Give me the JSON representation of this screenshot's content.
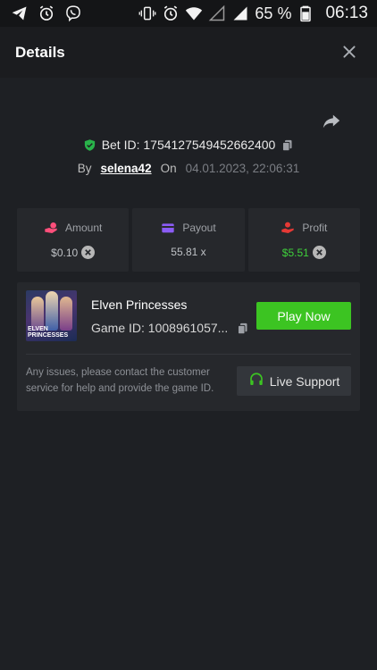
{
  "statusbar": {
    "battery_percent": "65 %",
    "time": "06:13",
    "icons": [
      "telegram-icon",
      "alarm-icon",
      "viber-icon",
      "vibrate-icon",
      "alarm-icon",
      "wifi-icon",
      "signal-empty-icon",
      "signal-icon",
      "battery-icon"
    ]
  },
  "header": {
    "title": "Details"
  },
  "bet": {
    "id_text": "Bet ID: 1754127549452662400",
    "by_label": "By",
    "user": "selena42",
    "on_label": "On",
    "date": "04.01.2023, 22:06:31"
  },
  "stats": [
    {
      "label": "Amount",
      "value": "$0.10",
      "icon": "amount-icon",
      "color": "#ff4f7b"
    },
    {
      "label": "Payout",
      "value": "55.81 x",
      "icon": "wallet-icon",
      "color": "#8b5cf6"
    },
    {
      "label": "Profit",
      "value": "$5.51",
      "icon": "profit-icon",
      "color": "#e53935"
    }
  ],
  "game": {
    "name": "Elven Princesses",
    "id_text": "Game ID: 1008961057...",
    "thumb_logo": "ELVEN PRINCESSES",
    "play_label": "Play Now",
    "issues_text": "Any issues, please contact the customer service for help and provide the game ID.",
    "support_label": "Live Support"
  },
  "colors": {
    "accent_green": "#3cc422",
    "background": "#1e2024",
    "card": "#26282c"
  }
}
